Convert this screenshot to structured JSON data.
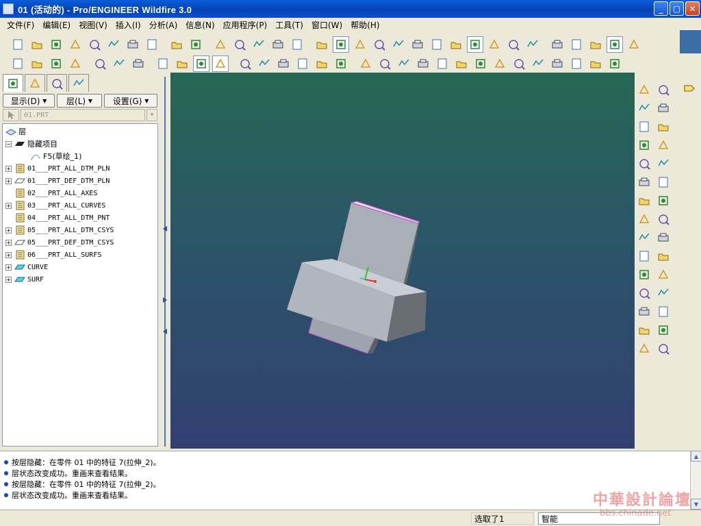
{
  "window": {
    "title": "01 (活动的) - Pro/ENGINEER Wildfire 3.0"
  },
  "menu": [
    "文件(F)",
    "编辑(E)",
    "视图(V)",
    "插入(I)",
    "分析(A)",
    "信息(N)",
    "应用程序(P)",
    "工具(T)",
    "窗口(W)",
    "帮助(H)"
  ],
  "toolbar": {
    "row1_icons": [
      "new-icon",
      "open-icon",
      "open-recent-icon",
      "save-icon",
      "save-copy-icon",
      "backup-icon",
      "print-icon",
      "regenerate-icon",
      "undo-icon",
      "redo-icon",
      "cut-icon",
      "copy-icon",
      "paste-icon",
      "paste-special-icon",
      "relations-icon",
      "repaint-icon",
      "spin-center-icon",
      "orient-mode-icon",
      "zoom-in-icon",
      "zoom-out-icon",
      "refit-icon",
      "reorient-icon",
      "saved-views-icon",
      "layers-icon",
      "view-manager-icon",
      "sketch-model-icon",
      "close-window-icon",
      "wireframe-icon",
      "hidden-line-icon",
      "no-hidden-icon",
      "shading-icon",
      "datum-planes-icon"
    ],
    "row2_icons": [
      "datum-plane-visibility-icon",
      "datum-axis-icon",
      "datum-points-icon",
      "coord-sys-icon",
      "curvature-icon",
      "measure-icon",
      "mannequin-icon",
      "draft-icon",
      "sketch-tool-icon",
      "color-icon",
      "appearance-icon",
      "datum-u-icon",
      "datum-r-icon",
      "datum-f-icon",
      "datum-g-icon",
      "datum-x-icon",
      "model-tree-icon",
      "distance-icon",
      "area-icon",
      "angle-icon",
      "section-icon",
      "mass-icon",
      "x-section-icon",
      "kit-icon",
      "color-map-icon",
      "graph-icon",
      "scenario-icon",
      "render-icon",
      "draw-icon",
      "teapot-icon",
      "photo-icon"
    ]
  },
  "navigator": {
    "tabs": [
      "model-tree-tab",
      "folder-browser-tab",
      "favorites-tab",
      "connections-tab"
    ],
    "show_label": "显示(D)",
    "layer_label": "层(L)",
    "settings_label": "设置(G)",
    "model_combo": "01.PRT",
    "tree": [
      {
        "label": "层",
        "indent": 0,
        "icon": "layer-stack-icon",
        "expander": false,
        "cn": true
      },
      {
        "label": "隐藏项目",
        "indent": 1,
        "icon": "hidden-layer-icon",
        "expander": true,
        "expanded": true,
        "cn": true
      },
      {
        "label": "F5(草绘_1)",
        "indent": 2,
        "icon": "sketch-curve-icon",
        "expander": false,
        "cn": true
      },
      {
        "label": "01___PRT_ALL_DTM_PLN",
        "indent": 1,
        "icon": "layer-doc-icon",
        "expander": true
      },
      {
        "label": "01___PRT_DEF_DTM_PLN",
        "indent": 1,
        "icon": "layer-plane-icon",
        "expander": true
      },
      {
        "label": "02___PRT_ALL_AXES",
        "indent": 1,
        "icon": "layer-doc-icon",
        "expander": false
      },
      {
        "label": "03___PRT_ALL_CURVES",
        "indent": 1,
        "icon": "layer-doc-icon",
        "expander": true
      },
      {
        "label": "04___PRT_ALL_DTM_PNT",
        "indent": 1,
        "icon": "layer-doc-icon",
        "expander": false
      },
      {
        "label": "05___PRT_ALL_DTM_CSYS",
        "indent": 1,
        "icon": "layer-doc-icon",
        "expander": true
      },
      {
        "label": "05___PRT_DEF_DTM_CSYS",
        "indent": 1,
        "icon": "layer-plane-icon",
        "expander": true
      },
      {
        "label": "06___PRT_ALL_SURFS",
        "indent": 1,
        "icon": "layer-doc-icon",
        "expander": true
      },
      {
        "label": "CURVE",
        "indent": 1,
        "icon": "layer-cyan-icon",
        "expander": true
      },
      {
        "label": "SURF",
        "indent": 1,
        "icon": "layer-cyan-icon",
        "expander": true
      }
    ]
  },
  "right_toolbar": [
    "mirror-icon",
    "copy-geom-icon",
    "note-icon",
    "datum-plane-icon",
    "hole-icon",
    "datum-axis-icon",
    "shell-icon",
    "datum-curve-icon",
    "rib-icon",
    "sketch-icon",
    "draft-icon",
    "datum-point-icon",
    "round-icon",
    "csys-icon",
    "chamfer-icon",
    "analysis-icon",
    "extrude-icon",
    "revolve-icon",
    "variable-sweep-icon",
    "blend-icon",
    "pattern-icon",
    "swept-blend-icon",
    "helix-icon",
    "boundary-icon",
    "trim-icon",
    "offset-icon",
    "thicken-icon",
    "merge-icon",
    "intersect-icon",
    "solidify-icon"
  ],
  "messages": [
    "按层隐藏：在零件 01 中的特征 7(拉伸_2)。",
    "层状态改变成功。重画来查看结果。",
    "按层隐藏：在零件 01 中的特征 7(拉伸_2)。",
    "层状态改变成功。重画来查看结果。"
  ],
  "status": {
    "selected": "选取了1",
    "filter": "智能"
  },
  "watermark": {
    "cn": "中華設計論壇",
    "en": "bbs.chinade.net"
  },
  "colors": {
    "viewport_top": "#266753",
    "viewport_bottom": "#323f72",
    "model_face": "#a6acb3",
    "model_edge": "#d64ad4",
    "title_blue": "#0541b9"
  }
}
